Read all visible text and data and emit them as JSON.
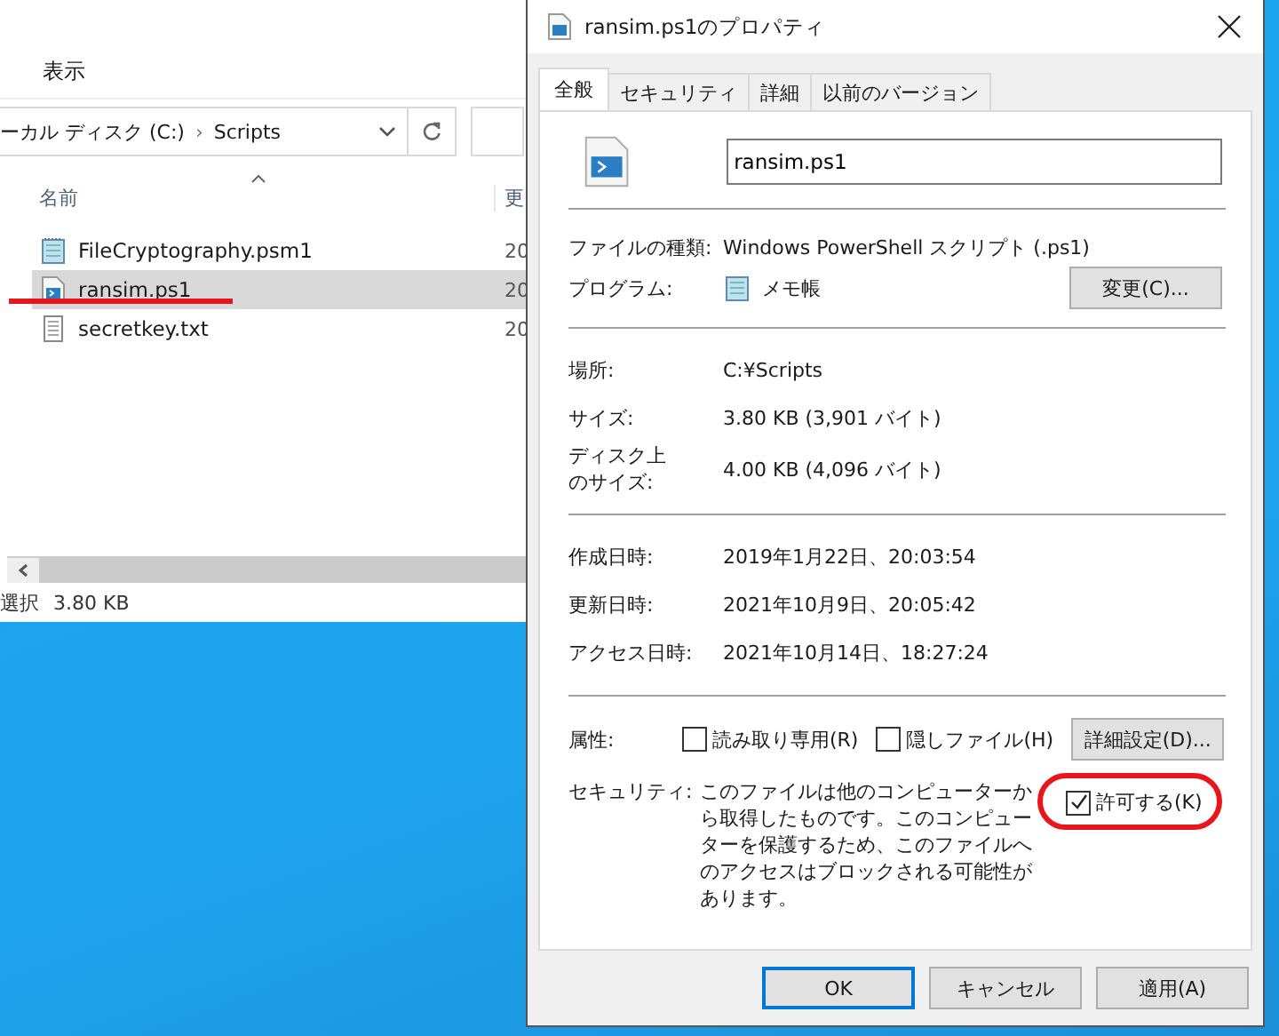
{
  "explorer": {
    "ribbon_tab": "表示",
    "address": {
      "drive": "ーカル ディスク (C:)",
      "separator": "›",
      "folder": "Scripts"
    },
    "columns": [
      "名前",
      "更"
    ],
    "files": [
      {
        "name": "FileCryptography.psm1",
        "kind": "module",
        "selected": false,
        "column_2": "20"
      },
      {
        "name": "ransim.ps1",
        "kind": "script",
        "selected": true,
        "column_2": "20"
      },
      {
        "name": "secretkey.txt",
        "kind": "text",
        "selected": false,
        "column_2": "20"
      }
    ],
    "status": {
      "selection": "選択",
      "size": "3.80 KB"
    }
  },
  "dialog": {
    "title": "ransim.ps1のプロパティ",
    "tabs": [
      {
        "label": "全般",
        "selected": true
      },
      {
        "label": "セキュリティ",
        "selected": false
      },
      {
        "label": "詳細",
        "selected": false
      },
      {
        "label": "以前のバージョン",
        "selected": false
      }
    ],
    "file_name": "ransim.ps1",
    "type": {
      "label": "ファイルの種類:",
      "value": "Windows PowerShell スクリプト (.ps1)"
    },
    "program": {
      "label": "プログラム:",
      "value": "メモ帳",
      "button": "変更(C)..."
    },
    "location_group": [
      {
        "label": "場所:",
        "value": "C:¥Scripts"
      },
      {
        "label": "サイズ:",
        "value": "3.80 KB (3,901 バイト)"
      },
      {
        "label": "ディスク上のサイズ:",
        "value": "4.00 KB (4,096 バイト)"
      }
    ],
    "dates": [
      {
        "label": "作成日時:",
        "value": "2019年1月22日、20:03:54"
      },
      {
        "label": "更新日時:",
        "value": "2021年10月9日、20:05:42"
      },
      {
        "label": "アクセス日時:",
        "value": "2021年10月14日、18:27:24"
      }
    ],
    "attributes": {
      "label": "属性:",
      "options": [
        {
          "label": "読み取り専用(R)",
          "checked": false
        },
        {
          "label": "隠しファイル(H)",
          "checked": false
        }
      ],
      "button": "詳細設定(D)..."
    },
    "security": {
      "label": "セキュリティ:",
      "text": "このファイルは他のコンピューターから取得したものです。このコンピューターを保護するため、このファイルへのアクセスはブロックされる可能性があります。",
      "checkbox": {
        "label": "許可する(K)",
        "checked": true
      }
    },
    "buttons": [
      {
        "label": "OK",
        "default": true
      },
      {
        "label": "キャンセル",
        "default": false
      },
      {
        "label": "適用(A)",
        "default": false
      }
    ]
  }
}
